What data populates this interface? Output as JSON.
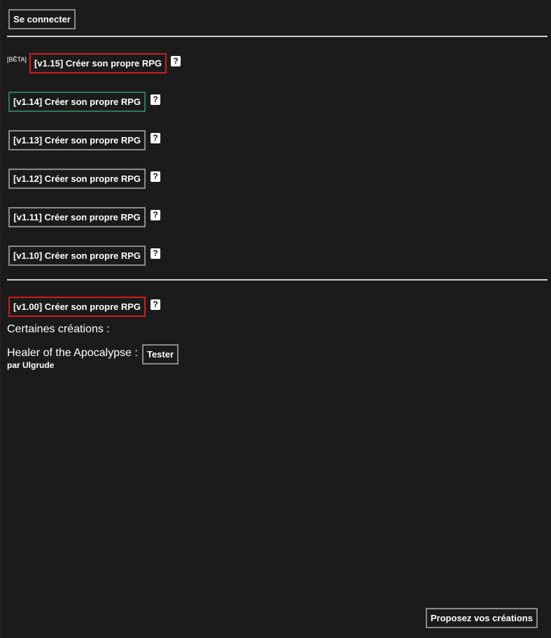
{
  "header": {
    "login_label": "Se connecter"
  },
  "versions": {
    "beta_tag": "[BÊTA]",
    "items": [
      {
        "label": "[v1.15] Créer son propre RPG",
        "help": "?"
      },
      {
        "label": "[v1.14] Créer son propre RPG",
        "help": "?"
      },
      {
        "label": "[v1.13] Créer son propre RPG",
        "help": "?"
      },
      {
        "label": "[v1.12] Créer son propre RPG",
        "help": "?"
      },
      {
        "label": "[v1.11] Créer son propre RPG",
        "help": "?"
      },
      {
        "label": "[v1.10] Créer son propre RPG",
        "help": "?"
      }
    ],
    "legacy": {
      "label": "[v1.00] Créer son propre RPG",
      "help": "?"
    }
  },
  "creations": {
    "heading": "Certaines créations :",
    "items": [
      {
        "title": "Healer of the Apocalypse :",
        "test_label": "Tester",
        "author": "par Ulgrude"
      }
    ]
  },
  "footer": {
    "submit_label": "Proposez vos créations"
  },
  "colors": {
    "background": "#1c1b1b",
    "border_default": "#8a8a8a",
    "border_highlight": "#cc1d1d",
    "border_current": "#2f7a52"
  }
}
